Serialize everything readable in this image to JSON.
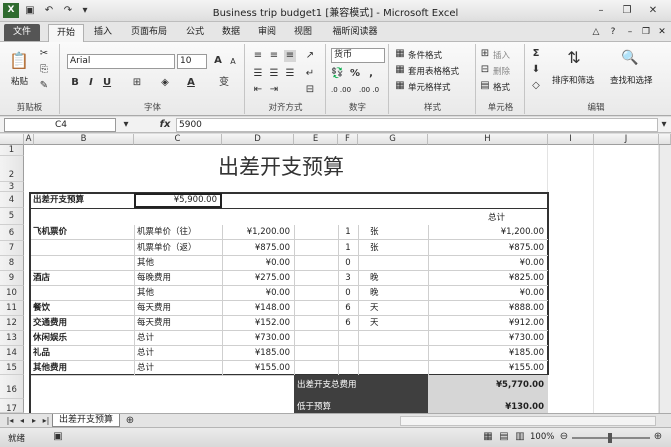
{
  "window": {
    "title": "Business trip budget1  [兼容模式] - Microsoft Excel",
    "app_icon": "excel-icon",
    "quick_access": [
      "save-icon",
      "undo-icon",
      "redo-icon",
      "customize-icon"
    ]
  },
  "tabs": [
    "文件",
    "开始",
    "插入",
    "页面布局",
    "公式",
    "数据",
    "审阅",
    "视图",
    "福昕阅读器"
  ],
  "ribbon": {
    "clipboard": {
      "label": "剪贴板",
      "paste": "粘贴"
    },
    "font": {
      "label": "字体",
      "name": "Arial",
      "size": "10",
      "bold": "B",
      "italic": "I",
      "underline": "U",
      "grow": "A",
      "shrink": "A",
      "wen": "变"
    },
    "alignment": {
      "label": "对齐方式"
    },
    "number": {
      "label": "数字",
      "format": "货币",
      "percent": "%",
      "comma": ",",
      "inc": ".0 .00",
      "dec": ".00 .0"
    },
    "styles": {
      "label": "样式",
      "cond": "条件格式",
      "table": "套用表格格式",
      "cell": "单元格样式"
    },
    "cells": {
      "label": "单元格",
      "insert": "插入",
      "delete": "删除",
      "format": "格式"
    },
    "editing": {
      "label": "编辑",
      "sort": "排序和筛选",
      "find": "查找和选择",
      "sigma": "Σ"
    }
  },
  "formula_bar": {
    "name_box": "C4",
    "fx": "fx",
    "value": "5900"
  },
  "columns": [
    "A",
    "B",
    "C",
    "D",
    "E",
    "F",
    "G",
    "H",
    "I",
    "J"
  ],
  "rows": [
    "1",
    "2",
    "3",
    "4",
    "5",
    "6",
    "7",
    "8",
    "9",
    "10",
    "11",
    "12",
    "13",
    "14",
    "15",
    "16",
    "17"
  ],
  "sheet": {
    "title": "出差开支预算",
    "budget_label": "出差开支预算",
    "budget_value": "¥5,900.00",
    "total_header": "总计",
    "lines": [
      {
        "cat": "飞机票价",
        "item": "机票单价（往）",
        "amount": "¥1,200.00",
        "qty": "1",
        "unit": "张",
        "total": "¥1,200.00"
      },
      {
        "cat": "",
        "item": "机票单价（返）",
        "amount": "¥875.00",
        "qty": "1",
        "unit": "张",
        "total": "¥875.00"
      },
      {
        "cat": "",
        "item": "其他",
        "amount": "¥0.00",
        "qty": "0",
        "unit": "",
        "total": "¥0.00"
      },
      {
        "cat": "酒店",
        "item": "每晚费用",
        "amount": "¥275.00",
        "qty": "3",
        "unit": "晚",
        "total": "¥825.00"
      },
      {
        "cat": "",
        "item": "其他",
        "amount": "¥0.00",
        "qty": "0",
        "unit": "晚",
        "total": "¥0.00"
      },
      {
        "cat": "餐饮",
        "item": "每天费用",
        "amount": "¥148.00",
        "qty": "6",
        "unit": "天",
        "total": "¥888.00"
      },
      {
        "cat": "交通费用",
        "item": "每天费用",
        "amount": "¥152.00",
        "qty": "6",
        "unit": "天",
        "total": "¥912.00"
      },
      {
        "cat": "休闲娱乐",
        "item": "总计",
        "amount": "¥730.00",
        "qty": "",
        "unit": "",
        "total": "¥730.00"
      },
      {
        "cat": "礼品",
        "item": "总计",
        "amount": "¥185.00",
        "qty": "",
        "unit": "",
        "total": "¥185.00"
      },
      {
        "cat": "其他费用",
        "item": "总计",
        "amount": "¥155.00",
        "qty": "",
        "unit": "",
        "total": "¥155.00"
      }
    ],
    "summary_total_label": "出差开支总费用",
    "summary_total_value": "¥5,770.00",
    "summary_under_label": "低于预算",
    "summary_under_value": "¥130.00"
  },
  "sheet_tabs": {
    "active": "出差开支预算"
  },
  "status": {
    "ready": "就绪",
    "zoom": "100%"
  },
  "colors": {
    "dark_panel": "#3f3f3f",
    "accent": "#2a6b2a"
  }
}
